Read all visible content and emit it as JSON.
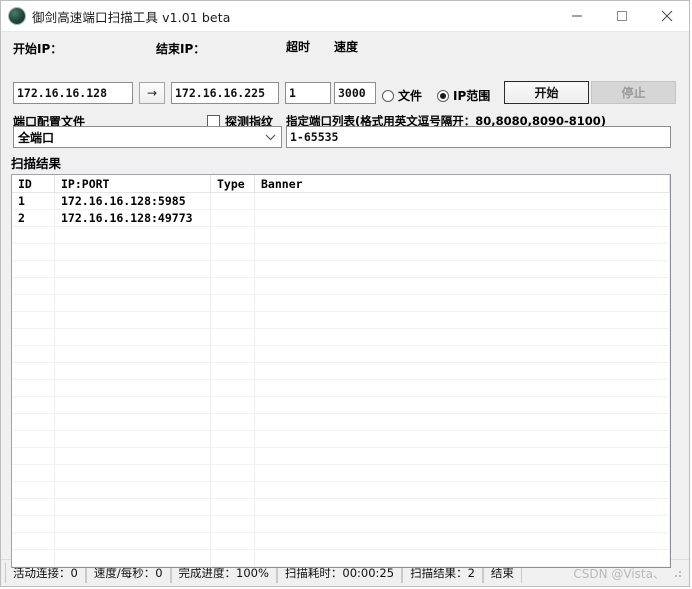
{
  "titlebar": {
    "icon": "app-globe-icon",
    "title": "御剑高速端口扫描工具 v1.01 beta",
    "minimize": "−",
    "maximize": "□",
    "close": "×"
  },
  "form": {
    "start_ip_label": "开始IP：",
    "start_ip_value": "172.16.16.128",
    "arrow_label": "→",
    "end_ip_label": "结束IP：",
    "end_ip_value": "172.16.16.225",
    "timeout_label": "超时",
    "timeout_value": "1",
    "speed_label": "速度",
    "speed_value": "3000",
    "radio_file_label": "文件",
    "radio_file_selected": false,
    "radio_iprange_label": "IP范围",
    "radio_iprange_selected": true,
    "start_button": "开始",
    "stop_button": "停止",
    "port_config_label": "端口配置文件",
    "port_config_value": "全端口",
    "fingerprint_label": "探测指纹",
    "fingerprint_checked": false,
    "port_list_label": "指定端口列表(格式用英文逗号隔开：80,8080,8090-8100)",
    "port_list_value": "1-65535"
  },
  "results": {
    "group_title": "扫描结果",
    "columns": [
      "ID",
      "IP:PORT",
      "Type",
      "Banner"
    ],
    "rows": [
      {
        "id": "1",
        "ipport": "172.16.16.128:5985",
        "type": "",
        "banner": ""
      },
      {
        "id": "2",
        "ipport": "172.16.16.128:49773",
        "type": "",
        "banner": ""
      }
    ]
  },
  "statusbar": {
    "cells": [
      "活动连接：0",
      "速度/每秒：0",
      "完成进度：100%",
      "扫描耗时：00:00:25",
      "扫描结果：2",
      "结束"
    ],
    "watermark": "CSDN @Vista、"
  }
}
